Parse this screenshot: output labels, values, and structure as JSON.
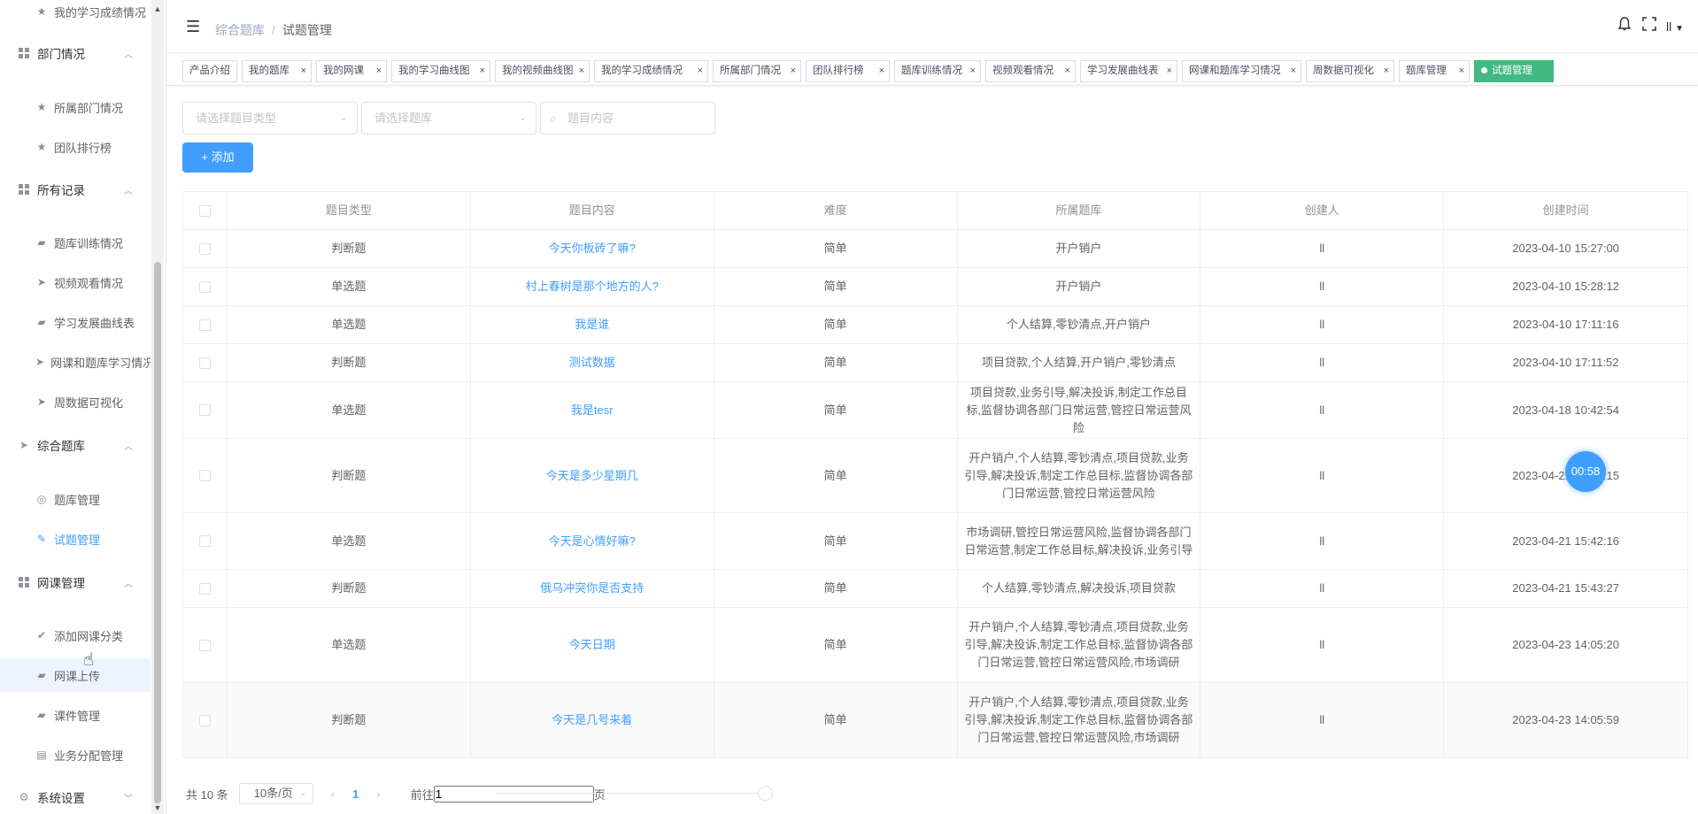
{
  "sidebar": {
    "items": [
      {
        "type": "item",
        "label": "我的学习成绩情况",
        "icon": "star-icon"
      },
      {
        "type": "group",
        "label": "部门情况",
        "icon": "grid-icon"
      },
      {
        "type": "item",
        "label": "所属部门情况",
        "icon": "star-icon"
      },
      {
        "type": "item",
        "label": "团队排行榜",
        "icon": "star-icon"
      },
      {
        "type": "group",
        "label": "所有记录",
        "icon": "grid-icon"
      },
      {
        "type": "item",
        "label": "题库训练情况",
        "icon": "briefcase-icon"
      },
      {
        "type": "item",
        "label": "视频观看情况",
        "icon": "send-icon"
      },
      {
        "type": "item",
        "label": "学习发展曲线表",
        "icon": "briefcase-icon"
      },
      {
        "type": "item",
        "label": "网课和题库学习情况",
        "icon": "send-icon"
      },
      {
        "type": "item",
        "label": "周数据可视化",
        "icon": "send-icon"
      },
      {
        "type": "group",
        "label": "综合题库",
        "icon": "send-icon"
      },
      {
        "type": "item",
        "label": "题库管理",
        "icon": "compass-icon"
      },
      {
        "type": "item",
        "label": "试题管理",
        "icon": "edit-icon",
        "active": true
      },
      {
        "type": "group",
        "label": "网课管理",
        "icon": "grid-icon"
      },
      {
        "type": "item",
        "label": "添加网课分类",
        "icon": "check-circle-icon"
      },
      {
        "type": "item",
        "label": "网课上传",
        "icon": "briefcase-icon"
      },
      {
        "type": "item",
        "label": "课件管理",
        "icon": "briefcase-icon"
      },
      {
        "type": "item",
        "label": "业务分配管理",
        "icon": "clipboard-icon"
      },
      {
        "type": "group",
        "label": "系统设置",
        "icon": "gear-icon"
      }
    ]
  },
  "header": {
    "breadcrumb": [
      "综合题库",
      "试题管理"
    ],
    "user": "ll"
  },
  "tags": [
    {
      "label": "产品介绍",
      "closable": false
    },
    {
      "label": "我的题库",
      "closable": true
    },
    {
      "label": "我的网课",
      "closable": true
    },
    {
      "label": "我的学习曲线图",
      "closable": true
    },
    {
      "label": "我的视频曲线图",
      "closable": true
    },
    {
      "label": "我的学习成绩情况",
      "closable": true
    },
    {
      "label": "所属部门情况",
      "closable": true
    },
    {
      "label": "团队排行榜",
      "closable": true
    },
    {
      "label": "题库训练情况",
      "closable": true
    },
    {
      "label": "视频观看情况",
      "closable": true
    },
    {
      "label": "学习发展曲线表",
      "closable": true
    },
    {
      "label": "网课和题库学习情况",
      "closable": true
    },
    {
      "label": "周数据可视化",
      "closable": true
    },
    {
      "label": "题库管理",
      "closable": true
    },
    {
      "label": "试题管理",
      "closable": false,
      "active": true
    }
  ],
  "filters": {
    "type_placeholder": "请选择题目类型",
    "bank_placeholder": "请选择题库",
    "search_placeholder": "题目内容"
  },
  "add_button": "+ 添加",
  "table": {
    "columns": [
      "题目类型",
      "题目内容",
      "难度",
      "所属题库",
      "创建人",
      "创建时间"
    ],
    "rows": [
      [
        "判断题",
        "今天你板砖了嘛?",
        "简单",
        "开户销户",
        "ll",
        "2023-04-10 15:27:00"
      ],
      [
        "单选题",
        "村上春树是那个地方的人?",
        "简单",
        "开户销户",
        "ll",
        "2023-04-10 15:28:12"
      ],
      [
        "单选题",
        "我是谁",
        "简单",
        "个人结算,零钞清点,开户销户",
        "ll",
        "2023-04-10 17:11:16"
      ],
      [
        "判断题",
        "测试数据",
        "简单",
        "项目贷款,个人结算,开户销户,零钞清点",
        "ll",
        "2023-04-10 17:11:52"
      ],
      [
        "单选题",
        "我是tesr",
        "简单",
        "项目贷款,业务引导,解决投诉,制定工作总目标,监督协调各部门日常运营,管控日常运营风险",
        "ll",
        "2023-04-18 10:42:54"
      ],
      [
        "判断题",
        "今天是多少星期几",
        "简单",
        "开户销户,个人结算,零钞清点,项目贷款,业务引导,解决投诉,制定工作总目标,监督协调各部门日常运营,管控日常运营风险",
        "ll",
        "2023-04-21 15:42:15"
      ],
      [
        "单选题",
        "今天是心情好嘛?",
        "简单",
        "市场调研,管控日常运营风险,监督协调各部门日常运营,制定工作总目标,解决投诉,业务引导",
        "ll",
        "2023-04-21 15:42:16"
      ],
      [
        "判断题",
        "俄乌冲突你是否支持",
        "简单",
        "个人结算,零钞清点,解决投诉,项目贷款",
        "ll",
        "2023-04-21 15:43:27"
      ],
      [
        "单选题",
        "今天日期",
        "简单",
        "开户销户,个人结算,零钞清点,项目贷款,业务引导,解决投诉,制定工作总目标,监督协调各部门日常运营,管控日常运营风险,市场调研",
        "ll",
        "2023-04-23 14:05:20"
      ],
      [
        "判断题",
        "今天是几号来着",
        "简单",
        "开户销户,个人结算,零钞清点,项目贷款,业务引导,解决投诉,制定工作总目标,监督协调各部门日常运营,管控日常运营风险,市场调研",
        "ll",
        "2023-04-23 14:05:59"
      ]
    ]
  },
  "pagination": {
    "total": "共 10 条",
    "page_size": "10条/页",
    "current_page": "1",
    "goto_prefix": "前往",
    "goto_value": "1",
    "goto_suffix": "页"
  },
  "timer": "00:58",
  "colors": {
    "primary": "#409eff",
    "active_tag": "#42b983"
  }
}
